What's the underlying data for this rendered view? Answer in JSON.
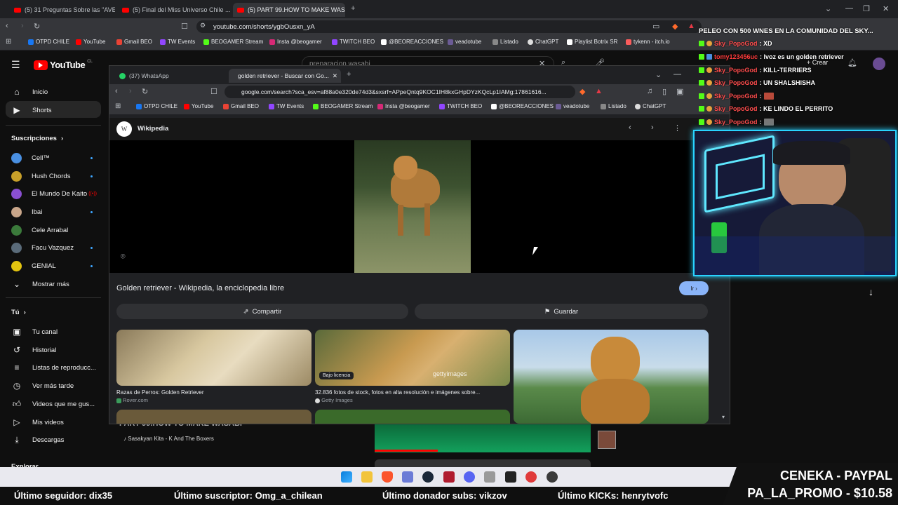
{
  "outer_browser": {
    "tabs": [
      {
        "label": "(5) 31 Preguntas Sobre las \"AVES\"",
        "active": false
      },
      {
        "label": "(5) Final del Miss Universo Chile ...",
        "active": false
      },
      {
        "label": "(5) PART 99.HOW TO MAKE WASA...",
        "active": true
      }
    ],
    "url": "youtube.com/shorts/ygbOusxn_yA",
    "bookmarks": [
      "OTPD CHILE",
      "YouTube",
      "Gmail BEO",
      "TW Events",
      "BEOGAMER Stream",
      "Insta @beogamer",
      "TWITCH BEO",
      "@BEOREACCIONES",
      "veadotube",
      "Listado",
      "ChatGPT",
      "Playlist Botrix SR",
      "tykenn - itch.io"
    ]
  },
  "youtube": {
    "logo": "YouTube",
    "country": "CL",
    "search_value": "preparacion wasabi",
    "create_label": "Crear",
    "sidebar": {
      "main": [
        "Inicio",
        "Shorts"
      ],
      "subs_header": "Suscripciones",
      "subs": [
        {
          "label": "Cell™",
          "color": "#4a90e2"
        },
        {
          "label": "Hush Chords",
          "color": "#c8a02a"
        },
        {
          "label": "El Mundo De Kaito",
          "color": "#8a4fd1"
        },
        {
          "label": "Ibai",
          "color": "#c9a68a"
        },
        {
          "label": "Cele Arrabal",
          "color": "#3b7a3b"
        },
        {
          "label": "Facu Vazquez",
          "color": "#5a6b7a"
        },
        {
          "label": "GENIAL",
          "color": "#e3c410"
        }
      ],
      "more": "Mostrar más",
      "you_header": "Tú",
      "you": [
        "Tu canal",
        "Historial",
        "Listas de reproducc...",
        "Ver más tarde",
        "Videos que me gus...",
        "Mis videos",
        "Descargas"
      ],
      "explore": "Explorar"
    },
    "video_title": "PART 99.HOW TO MAKE WASABI",
    "song": "Sasakyan Kita - K And The Boxers"
  },
  "inner_browser": {
    "tabs": [
      {
        "label": "(37) WhatsApp",
        "active": false
      },
      {
        "label": "golden retriever - Buscar con Go...",
        "active": true
      }
    ],
    "url": "google.com/search?sca_esv=af88a0e320de74d3&sxsrf=APpeQntq9KOC1IH8kxGHpDYzKQcLp1IAMg:17861616...",
    "bookmarks": [
      "OTPD CHILE",
      "YouTube",
      "Gmail BEO",
      "TW Events",
      "BEOGAMER Stream",
      "Insta @beogamer",
      "TWITCH BEO",
      "@BEOREACCIONES",
      "veadotube",
      "Listado",
      "ChatGPT"
    ],
    "source_name": "Wikipedia",
    "result_title": "Golden retriever - Wikipedia, la enciclopedia libre",
    "go_label": "Ir",
    "share_label": "Compartir",
    "save_label": "Guardar",
    "related": [
      {
        "caption": "Razas de Perros: Golden Retriever",
        "source": "Rover.com",
        "badge": ""
      },
      {
        "caption": "32.836 fotos de stock, fotos en alta resolución e imágenes sobre...",
        "source": "Getty Images",
        "badge": "Bajo licencia"
      },
      {
        "caption": "",
        "source": "",
        "badge": ""
      }
    ],
    "getty_watermark": "gettyimages"
  },
  "chat": {
    "header": "PELEO CON 500 WNES EN LA COMUNIDAD DEL SKY...",
    "messages": [
      {
        "user": "Sky_PopoGod",
        "text": ": XD",
        "color": "#ff4d4d"
      },
      {
        "user": "tomy123456uc",
        "text": ": Ivoz es un golden retriever",
        "color": "#ff3b3b"
      },
      {
        "user": "Sky_PopoGod",
        "text": ": KILL-TERRIERS",
        "color": "#ff4d4d"
      },
      {
        "user": "Sky_PopoGod",
        "text": ": UN SHALSHISHA",
        "color": "#ff4d4d"
      },
      {
        "user": "Sky_PopoGod",
        "text": ":",
        "color": "#ff4d4d"
      },
      {
        "user": "Sky_PopoGod",
        "text": ": KE LINDO EL PERRITO",
        "color": "#ff4d4d"
      },
      {
        "user": "Sky_PopoGod",
        "text": ":",
        "color": "#ff4d4d"
      }
    ]
  },
  "ticker": {
    "follower": "Último seguidor: dix35",
    "subscriber": "Último suscriptor: Omg_a_chilean",
    "donor": "Último donador subs: vikzov",
    "kicks": "Último KICKs: henrytvofc"
  },
  "promo": {
    "line1": "CENEKA - PAYPAL",
    "line2": "PA_LA_PROMO - $10.58"
  }
}
